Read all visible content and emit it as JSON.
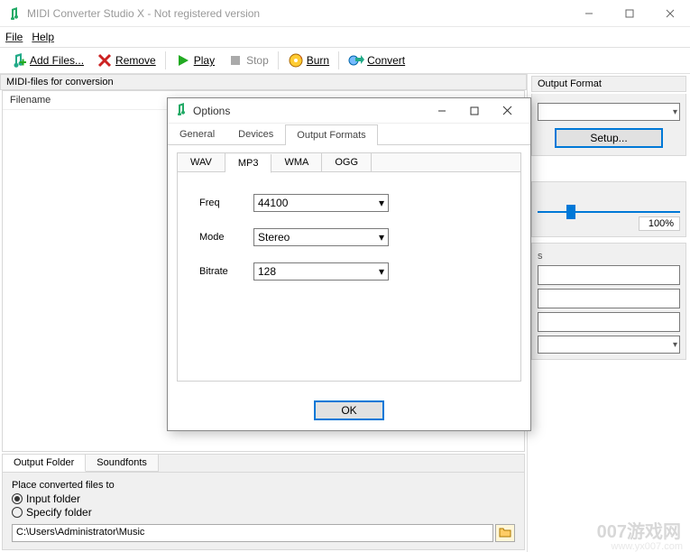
{
  "window": {
    "title": "MIDI Converter Studio X - Not registered version"
  },
  "menu": {
    "file": "File",
    "help": "Help"
  },
  "toolbar": {
    "add_files": "Add Files...",
    "remove": "Remove",
    "play": "Play",
    "stop": "Stop",
    "burn": "Burn",
    "convert": "Convert"
  },
  "left": {
    "section_label": "MIDI-files for conversion",
    "filename_header": "Filename",
    "tabs": {
      "output_folder": "Output Folder",
      "soundfonts": "Soundfonts"
    },
    "place_label": "Place converted files to",
    "radio_input": "Input folder",
    "radio_specify": "Specify folder",
    "path_value": "C:\\Users\\Administrator\\Music"
  },
  "right": {
    "output_format_title": "Output Format",
    "setup_label": "Setup...",
    "slider_value": "100%"
  },
  "dialog": {
    "title": "Options",
    "tabs": {
      "general": "General",
      "devices": "Devices",
      "output_formats": "Output Formats"
    },
    "sub_tabs": {
      "wav": "WAV",
      "mp3": "MP3",
      "wma": "WMA",
      "ogg": "OGG"
    },
    "freq_label": "Freq",
    "freq_value": "44100",
    "mode_label": "Mode",
    "mode_value": "Stereo",
    "bitrate_label": "Bitrate",
    "bitrate_value": "128",
    "ok_label": "OK"
  },
  "watermark": {
    "line1": "007游戏网",
    "line2": "www.yx007.com"
  }
}
